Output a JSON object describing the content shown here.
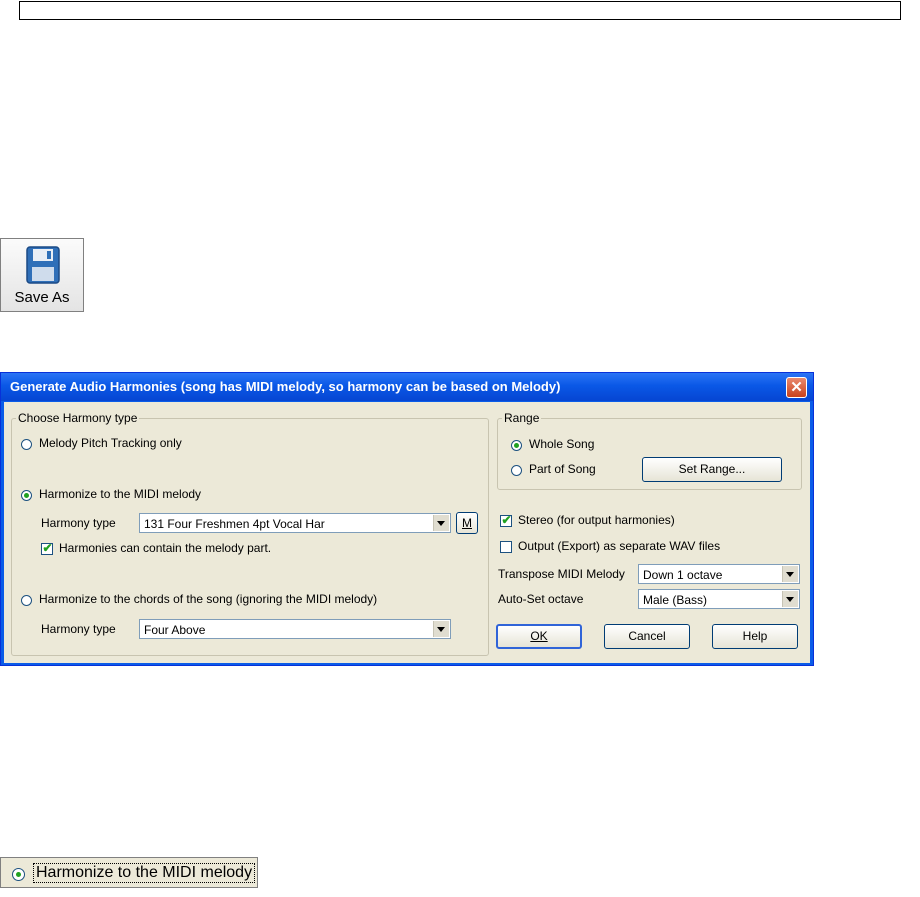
{
  "save_button": {
    "label": "Save As",
    "icon": "floppy-disk-icon"
  },
  "dialog": {
    "title": "Generate Audio Harmonies (song has MIDI melody, so harmony can be based on Melody)",
    "harmony_group": {
      "legend": "Choose Harmony type",
      "option_pitch": "Melody Pitch Tracking only",
      "option_midi": "Harmonize to the MIDI melody",
      "harmony_type_label_1": "Harmony type",
      "harmony_type_value_1": "131 Four Freshmen 4pt Vocal Har",
      "m_button": "M",
      "contain_melody": "Harmonies can contain the melody part.",
      "option_chords": "Harmonize to the chords of the song   (ignoring the MIDI melody)",
      "harmony_type_label_2": "Harmony type",
      "harmony_type_value_2": "Four Above"
    },
    "range_group": {
      "legend": "Range",
      "whole_song": "Whole Song",
      "part_of_song": "Part of Song",
      "set_range": "Set Range..."
    },
    "stereo": "Stereo (for output harmonies)",
    "export_wav": "Output (Export) as separate WAV files",
    "transpose_label": "Transpose MIDI Melody",
    "transpose_value": "Down 1 octave",
    "autoset_label": "Auto-Set octave",
    "autoset_value": "Male (Bass)",
    "ok": "OK",
    "cancel": "Cancel",
    "help": "Help"
  },
  "snippet": {
    "label": "Harmonize to the MIDI melody"
  },
  "colors": {
    "title_bar": "#0a58e6",
    "dialog_bg": "#ece9d8",
    "close_button": "#c9411c"
  }
}
